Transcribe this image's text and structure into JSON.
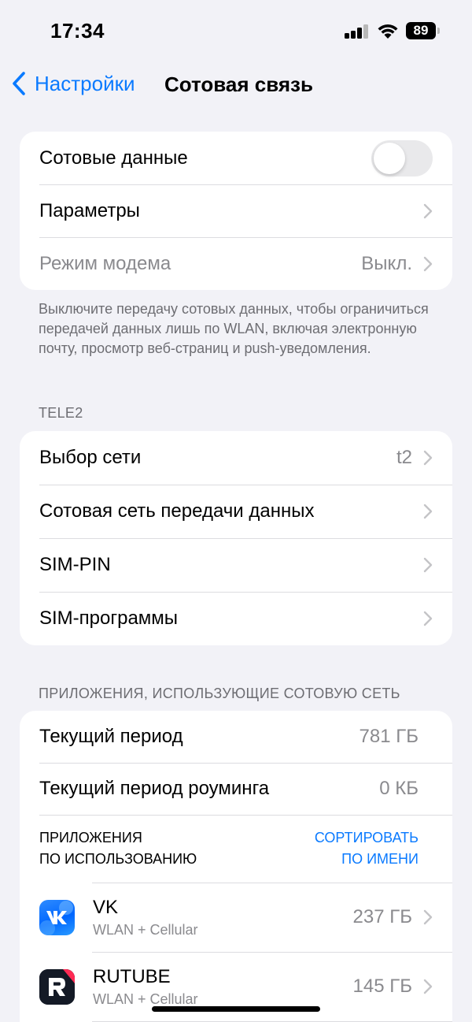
{
  "status": {
    "time": "17:34",
    "battery": "89"
  },
  "nav": {
    "back_label": "Настройки",
    "title": "Сотовая связь"
  },
  "group1": {
    "cellular_data_label": "Сотовые данные",
    "cellular_data_on": false,
    "options_label": "Параметры",
    "hotspot_label": "Режим модема",
    "hotspot_value": "Выкл."
  },
  "footnote": "Выключите передачу сотовых данных, чтобы ограничиться передачей данных лишь по WLAN, включая электронную почту, просмотр веб-страниц и push-уведомления.",
  "carrier": {
    "header": "TELE2",
    "rows": [
      {
        "label": "Выбор сети",
        "value": "t2"
      },
      {
        "label": "Сотовая сеть передачи данных",
        "value": ""
      },
      {
        "label": "SIM-PIN",
        "value": ""
      },
      {
        "label": "SIM-программы",
        "value": ""
      }
    ]
  },
  "apps": {
    "header": "ПРИЛОЖЕНИЯ, ИСПОЛЬЗУЮЩИЕ СОТОВУЮ СЕТЬ",
    "current_period_label": "Текущий период",
    "current_period_value": "781 ГБ",
    "roaming_label": "Текущий период роуминга",
    "roaming_value": "0 КБ",
    "sort_left_1": "ПРИЛОЖЕНИЯ",
    "sort_left_2": "ПО ИСПОЛЬЗОВАНИЮ",
    "sort_right_1": "СОРТИРОВАТЬ",
    "sort_right_2": "ПО ИМЕНИ",
    "list": [
      {
        "name": "VK",
        "sub": "WLAN + Cellular",
        "size": "237 ГБ",
        "icon": "vk-icon",
        "color": "#0077ff"
      },
      {
        "name": "RUTUBE",
        "sub": "WLAN + Cellular",
        "size": "145 ГБ",
        "icon": "rutube-icon",
        "color": "#14191f"
      }
    ]
  }
}
